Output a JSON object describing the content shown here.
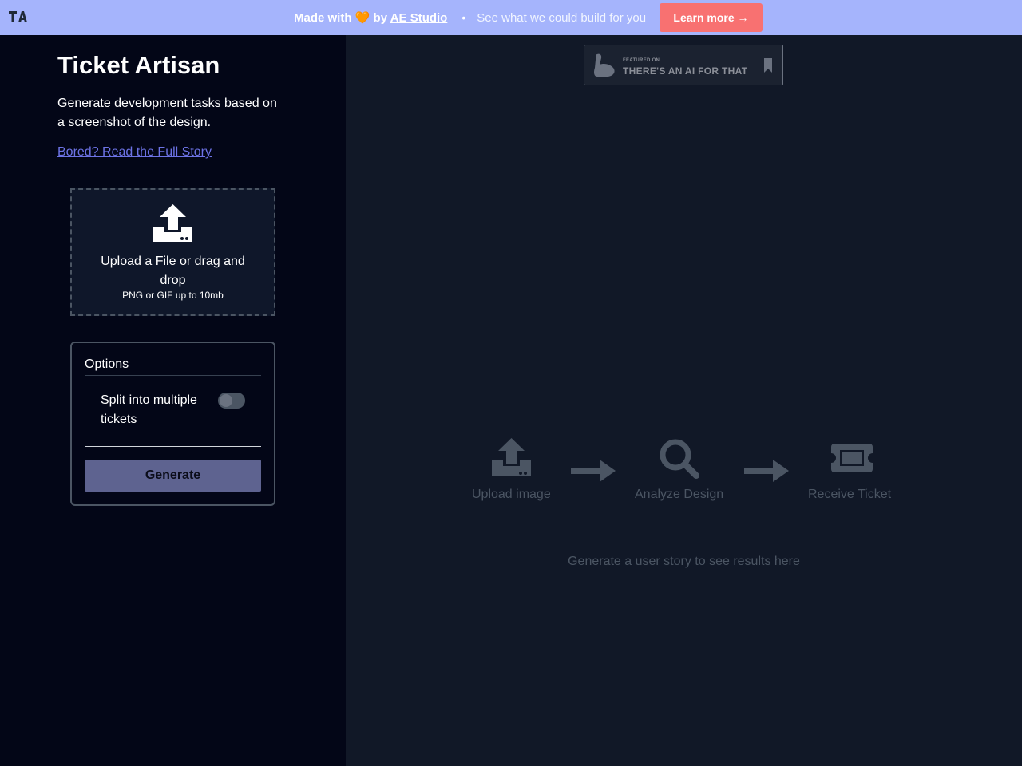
{
  "banner": {
    "logo_text": "TA",
    "made_with": "Made with",
    "heart": "🧡",
    "by": "by",
    "studio_link": "AE Studio",
    "separator": "•",
    "tagline": "See what we could build for you",
    "learn_more": "Learn more →"
  },
  "sidebar": {
    "title": "Ticket Artisan",
    "description": "Generate development tasks based on a screenshot of the design.",
    "story_link": "Bored? Read the Full Story",
    "upload": {
      "icon": "upload-icon",
      "label": "Upload a File or drag and drop",
      "hint": "PNG or GIF up to 10mb"
    },
    "options": {
      "title": "Options",
      "split_label": "Split into multiple tickets",
      "split_enabled": false,
      "generate_label": "Generate"
    }
  },
  "main": {
    "badge_small": "FEATURED ON",
    "badge_big": "THERE'S AN AI FOR THAT",
    "steps": [
      {
        "icon": "upload-icon",
        "label": "Upload image"
      },
      {
        "icon": "search-icon",
        "label": "Analyze Design"
      },
      {
        "icon": "ticket-icon",
        "label": "Receive Ticket"
      }
    ],
    "empty_message": "Generate a user story to see results here"
  },
  "colors": {
    "banner_bg": "#a5b4fc",
    "learn_more_bg": "#f87171",
    "sidebar_bg": "#030617",
    "main_bg": "#111827",
    "link": "#6d73e6",
    "generate_bg": "#5e6390",
    "muted": "#4b5563"
  }
}
